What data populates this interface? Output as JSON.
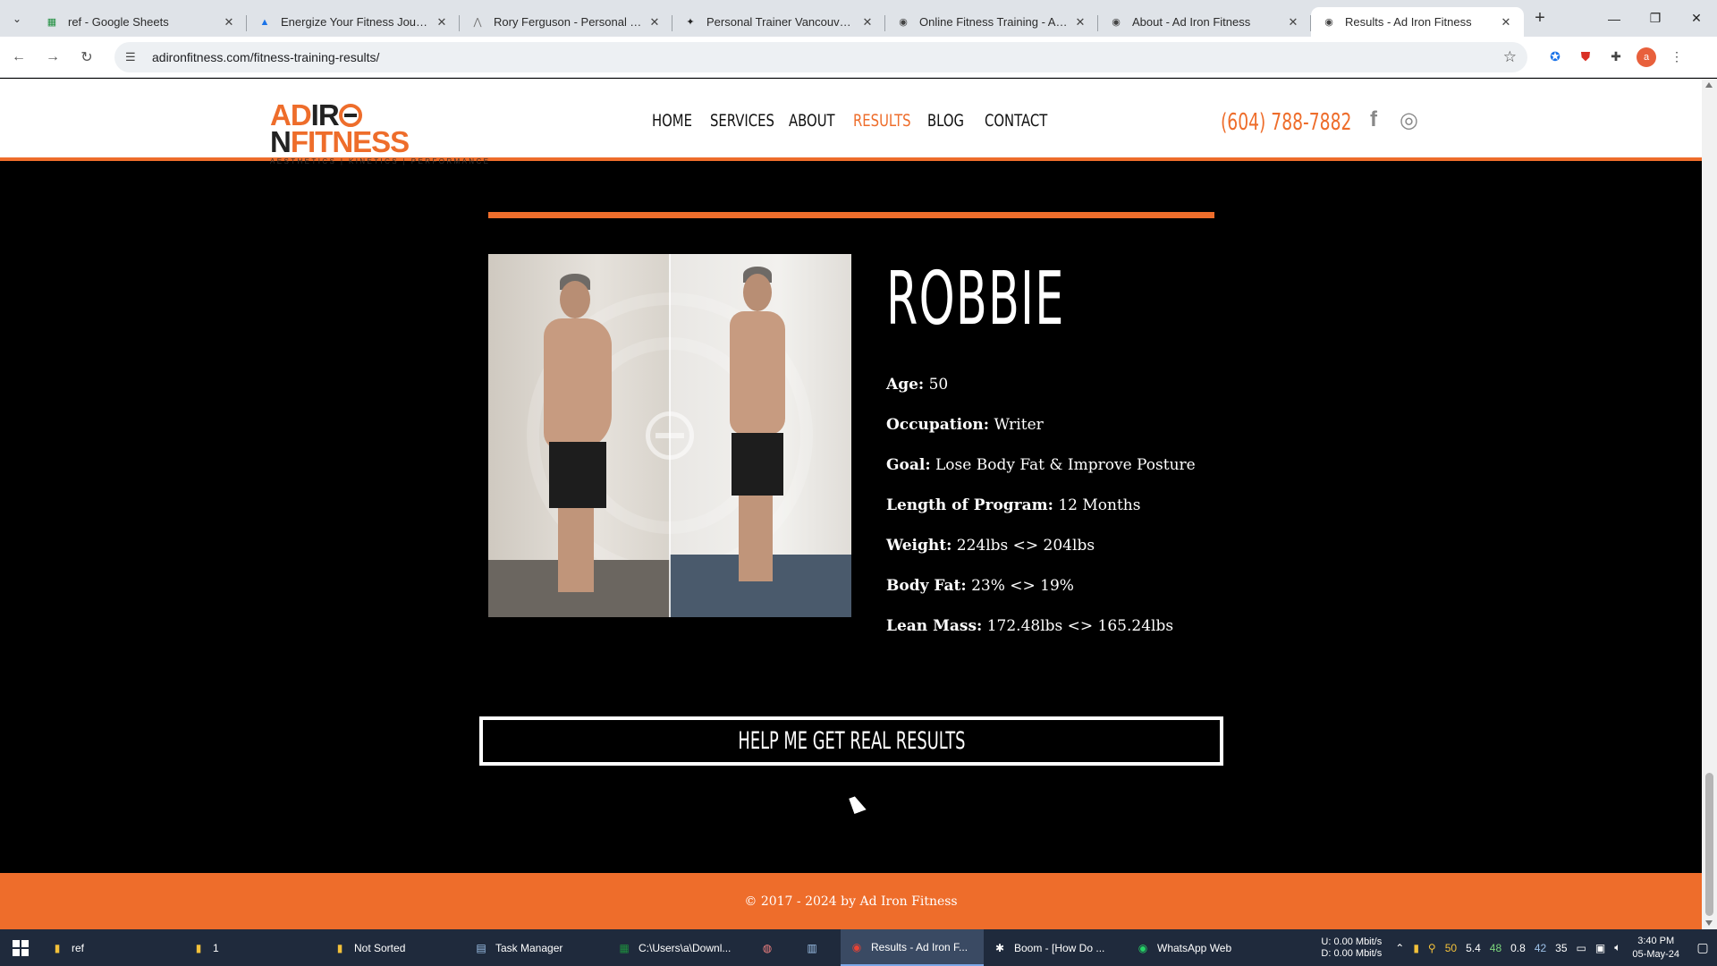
{
  "browser": {
    "tabs": [
      {
        "title": "ref - Google Sheets",
        "icon": "sheets-icon",
        "color": "#1e8e3e",
        "glyph": "▦"
      },
      {
        "title": "Energize Your Fitness Journey w",
        "icon": "arrow-logo-icon",
        "color": "#1a73e8",
        "glyph": "▲"
      },
      {
        "title": "Rory Ferguson - Personal Traini",
        "icon": "arrow-logo-icon",
        "color": "#777777",
        "glyph": "⋀"
      },
      {
        "title": "Personal Trainer Vancouver | W",
        "icon": "runner-icon",
        "color": "#222222",
        "glyph": "✦"
      },
      {
        "title": "Online Fitness Training - Ad Iro",
        "icon": "adiron-favicon-icon",
        "color": "#444444",
        "glyph": "◉"
      },
      {
        "title": "About - Ad Iron Fitness",
        "icon": "adiron-favicon-icon",
        "color": "#444444",
        "glyph": "◉"
      },
      {
        "title": "Results - Ad Iron Fitness",
        "icon": "adiron-favicon-icon",
        "color": "#444444",
        "glyph": "◉",
        "active": true
      }
    ],
    "url": "adironfitness.com/fitness-training-results/",
    "profile_initial": "a"
  },
  "site": {
    "logo": {
      "part1": "AD",
      "part2": "IR",
      "part3": "N",
      "part4": "FITNESS",
      "tagline": "AESTHETICS | KINETICS | PERFORMANCE"
    },
    "nav": [
      {
        "label": "HOME",
        "current": false
      },
      {
        "label": "SERVICES",
        "current": false
      },
      {
        "label": "ABOUT",
        "current": false
      },
      {
        "label": "RESULTS",
        "current": true
      },
      {
        "label": "BLOG",
        "current": false
      },
      {
        "label": "CONTACT",
        "current": false
      }
    ],
    "phone": "(604) 788-7882",
    "accent": "#ee6d2b"
  },
  "result": {
    "name": "ROBBIE",
    "stats": [
      {
        "key": "Age:",
        "value": "50"
      },
      {
        "key": "Occupation:",
        "value": "Writer"
      },
      {
        "key": "Goal:",
        "value": "Lose Body Fat & Improve Posture"
      },
      {
        "key": "Length of Program:",
        "value": "12 Months"
      },
      {
        "key": "Weight:",
        "value": "224lbs <> 204lbs"
      },
      {
        "key": "Body Fat:",
        "value": "23% <> 19%"
      },
      {
        "key": "Lean Mass:",
        "value": "172.48lbs <> 165.24lbs"
      }
    ],
    "cta": "HELP ME GET REAL RESULTS"
  },
  "footer": {
    "text": "© 2017 - 2024 by Ad Iron Fitness"
  },
  "taskbar": {
    "items": [
      {
        "label": "ref",
        "icon": "folder-icon",
        "glyph": "▮",
        "color": "#f3c13a"
      },
      {
        "label": "1",
        "icon": "folder-icon",
        "glyph": "▮",
        "color": "#f3c13a"
      },
      {
        "label": "Not Sorted",
        "icon": "folder-icon",
        "glyph": "▮",
        "color": "#f3c13a"
      },
      {
        "label": "Task Manager",
        "icon": "task-manager-icon",
        "glyph": "▤",
        "color": "#9ec3ea"
      },
      {
        "label": "C:\\Users\\a\\Downl...",
        "icon": "excel-icon",
        "glyph": "▦",
        "color": "#1e8e3e"
      },
      {
        "label": "",
        "icon": "app-icon",
        "glyph": "◍",
        "color": "#f08080"
      },
      {
        "label": "",
        "icon": "notepad-icon",
        "glyph": "▥",
        "color": "#9ec3ea"
      },
      {
        "label": "Results - Ad Iron F...",
        "icon": "chrome-icon",
        "glyph": "◉",
        "color": "#ea4335",
        "active": true
      },
      {
        "label": "Boom - [How Do ...",
        "icon": "boom-icon",
        "glyph": "✱",
        "color": "#ffffff"
      },
      {
        "label": "WhatsApp Web",
        "icon": "whatsapp-icon",
        "glyph": "◉",
        "color": "#25d366"
      }
    ],
    "net_up": "0.00 Mbit/s",
    "net_down": "0.00 Mbit/s",
    "net_up_label": "U:",
    "net_down_label": "D:",
    "tray_values": [
      "50",
      "5.4",
      "48",
      "0.8",
      "42",
      "35"
    ],
    "time": "3:40 PM",
    "date": "05-May-24"
  }
}
